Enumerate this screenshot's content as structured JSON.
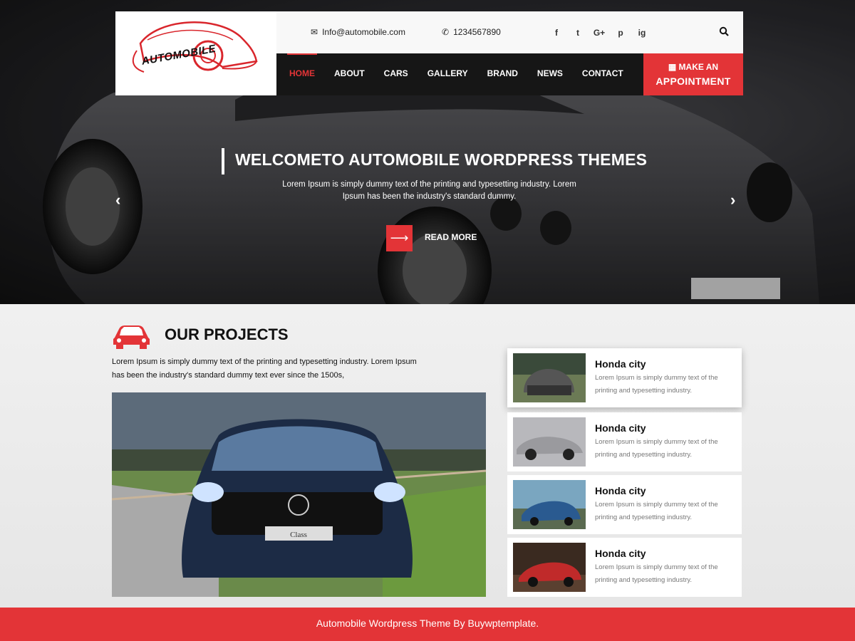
{
  "logo": {
    "text": "AUTOMOBILE"
  },
  "topbar": {
    "email": "Info@automobile.com",
    "phone": "1234567890",
    "social": [
      "f",
      "t",
      "G+",
      "p",
      "ig"
    ]
  },
  "nav": {
    "items": [
      "HOME",
      "ABOUT",
      "CARS",
      "GALLERY",
      "BRAND",
      "NEWS",
      "CONTACT"
    ],
    "active": "HOME"
  },
  "appointment": {
    "line1": "MAKE AN",
    "line2": "APPOINTMENT"
  },
  "hero": {
    "title": "WELCOMETO AUTOMOBILE WORDPRESS THEMES",
    "desc": "Lorem Ipsum is simply dummy text of the printing and typesetting industry. Lorem Ipsum has been the industry's standard dummy.",
    "read_more": "READ MORE",
    "prev": "‹",
    "next": "›",
    "arrow": "⟶"
  },
  "projects": {
    "title": "OUR PROJECTS",
    "desc": "Lorem Ipsum is simply dummy text of the printing and typesetting industry. Lorem Ipsum has been the industry's standard dummy text ever since the 1500s,",
    "main_plate": "Class",
    "cards": [
      {
        "title": "Honda city",
        "desc": "Lorem Ipsum is simply dummy text of the printing and typesetting industry."
      },
      {
        "title": "Honda city",
        "desc": "Lorem Ipsum is simply dummy text of the printing and typesetting industry."
      },
      {
        "title": "Honda city",
        "desc": "Lorem Ipsum is simply dummy text of the printing and typesetting industry."
      },
      {
        "title": "Honda city",
        "desc": "Lorem Ipsum is simply dummy text of the printing and typesetting industry."
      }
    ]
  },
  "footer": {
    "text": "Automobile Wordpress Theme By Buywptemplate."
  },
  "colors": {
    "accent": "#e33437",
    "nav_bg": "#161616",
    "topbar_bg": "#f8f8f8"
  }
}
